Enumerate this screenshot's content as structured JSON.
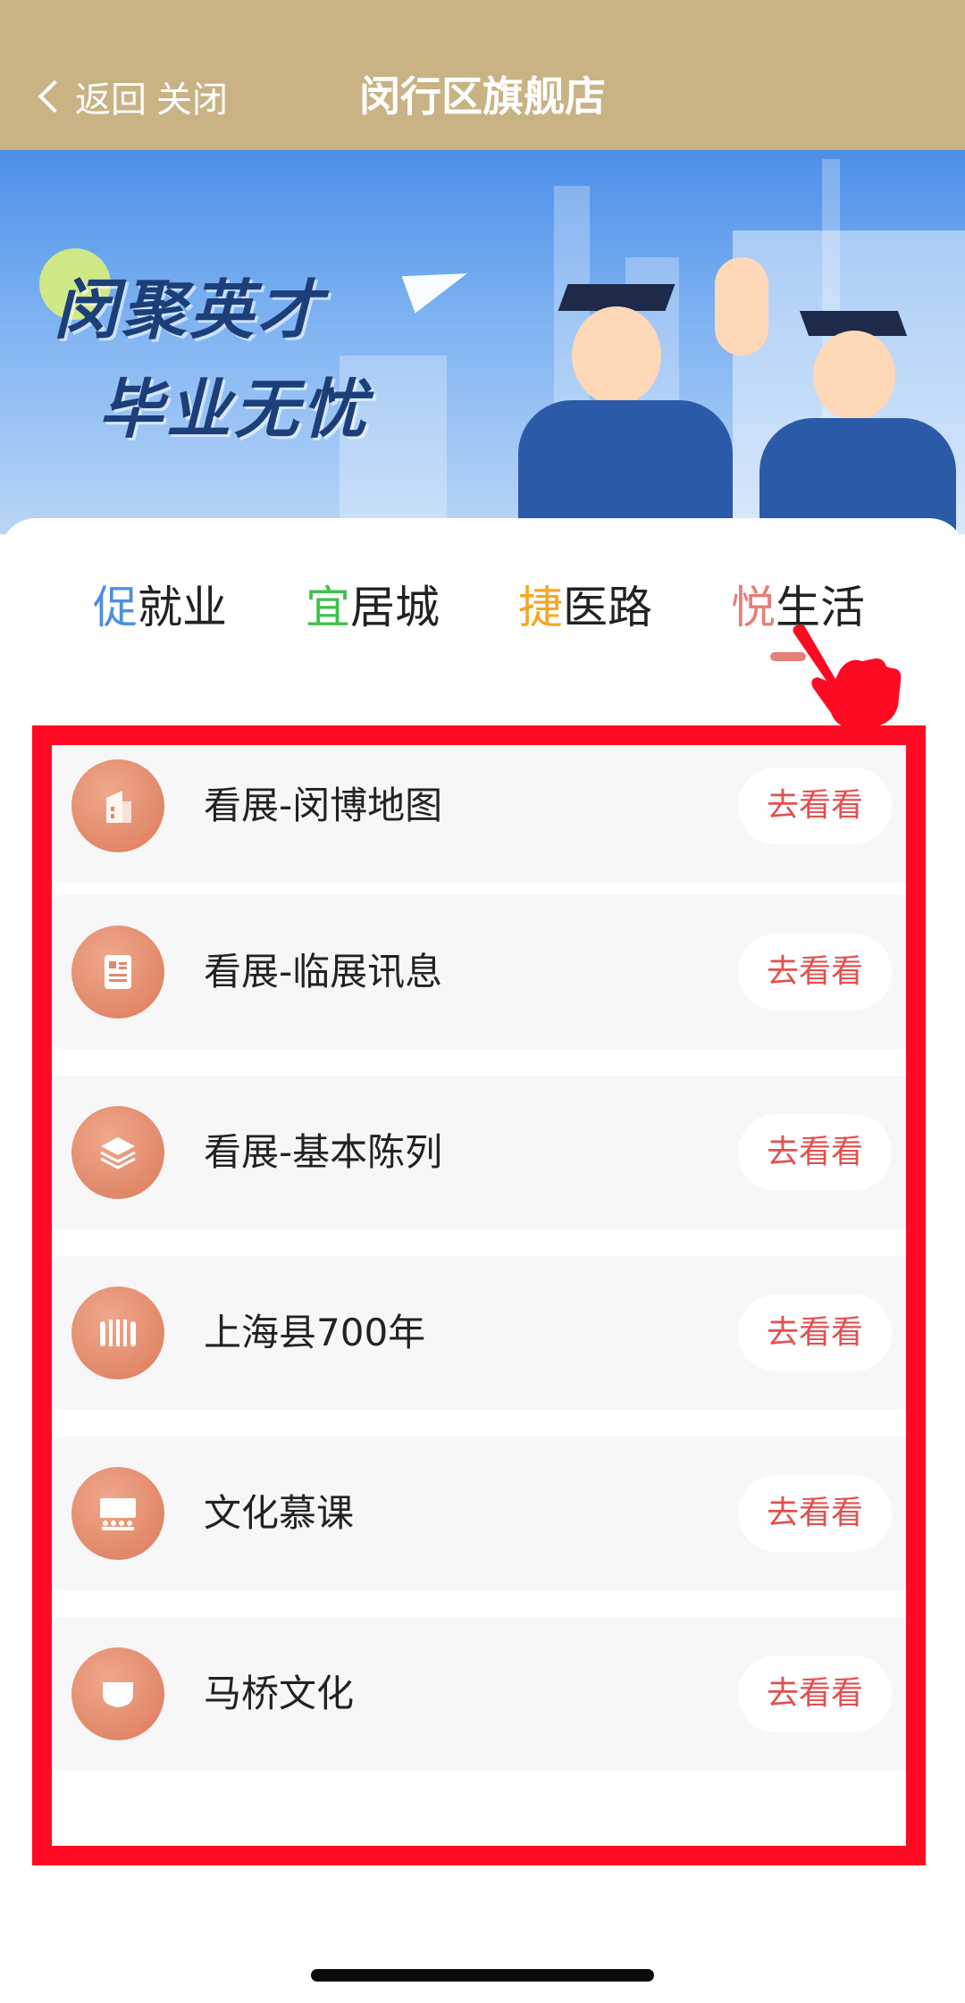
{
  "navbar": {
    "back_label": "返回",
    "close_label": "关闭",
    "title": "闵行区旗舰店"
  },
  "banner": {
    "line1": "闵聚英才",
    "line2": "毕业无忧"
  },
  "tabs": [
    {
      "accent": "促",
      "rest": "就业",
      "accent_color": "#4a90e2"
    },
    {
      "accent": "宜",
      "rest": "居城",
      "accent_color": "#3cc24a"
    },
    {
      "accent": "捷",
      "rest": "医路",
      "accent_color": "#f5a623"
    },
    {
      "accent": "悦",
      "rest": "生活",
      "accent_color": "#e5807a"
    }
  ],
  "list": {
    "button_label": "去看看",
    "items": [
      {
        "label": "看展-闵博地图",
        "icon": "building-icon"
      },
      {
        "label": "看展-临展讯息",
        "icon": "document-icon"
      },
      {
        "label": "看展-基本陈列",
        "icon": "layers-icon"
      },
      {
        "label": "上海县700年",
        "icon": "scroll-icon"
      },
      {
        "label": "文化慕课",
        "icon": "lecture-icon"
      },
      {
        "label": "马桥文化",
        "icon": "bowl-icon"
      }
    ]
  },
  "colors": {
    "navbar": "#c9b284",
    "highlight_frame": "#ff0a23",
    "button_text": "#e34f4f",
    "icon_bg": "#e28869"
  }
}
